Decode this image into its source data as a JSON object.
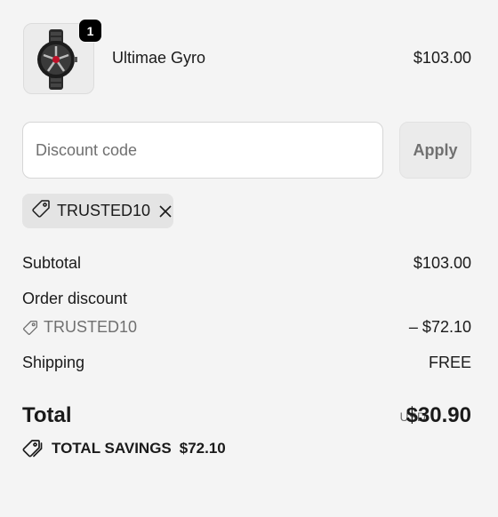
{
  "line_item": {
    "quantity": "1",
    "name": "Ultimae Gyro",
    "price": "$103.00",
    "image": "watch-product-image"
  },
  "discount": {
    "placeholder": "Discount code",
    "apply_label": "Apply",
    "applied_code": "TRUSTED10"
  },
  "summary": {
    "subtotal_label": "Subtotal",
    "subtotal_value": "$103.00",
    "order_discount_label": "Order discount",
    "discount_code": "TRUSTED10",
    "discount_value": "– $72.10",
    "shipping_label": "Shipping",
    "shipping_value": "FREE",
    "total_label": "Total",
    "currency": "USD",
    "total_value": "$30.90",
    "savings_label": "TOTAL SAVINGS",
    "savings_value": "$72.10"
  },
  "icons": [
    "tag-icon",
    "close-icon",
    "tags-icon"
  ],
  "colors": {
    "background": "#f4f4f4",
    "badge": "#000000",
    "muted": "#707070",
    "chip": "#e4e4e4"
  }
}
